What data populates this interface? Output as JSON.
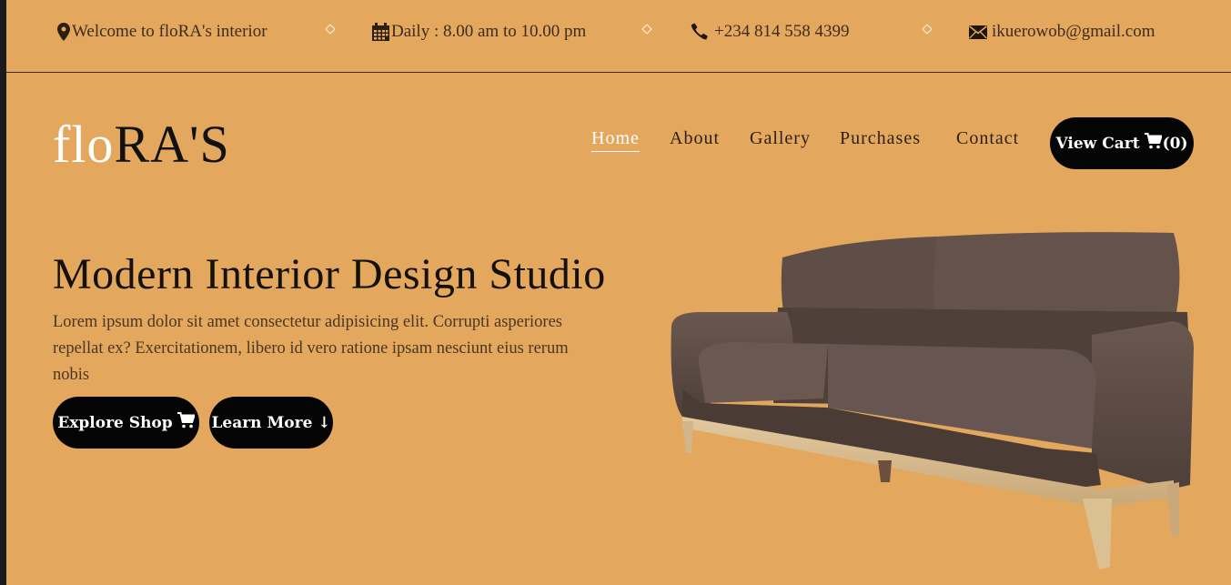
{
  "topbar": {
    "welcome": "Welcome to floRA's interior",
    "hours": "Daily : 8.00 am to 10.00 pm",
    "phone": "+234 814 558 4399",
    "email": "ikuerowob@gmail.com"
  },
  "header": {
    "logo_light": "flo",
    "logo_dark": "RA'S",
    "nav": [
      "Home",
      "About",
      "Gallery",
      "Purchases",
      "Contact"
    ],
    "active_nav": "Home",
    "cart_label": "View Cart",
    "cart_count": "(0)"
  },
  "hero": {
    "title": "Modern Interior Design Studio",
    "text": "Lorem ipsum dolor sit amet consectetur adipisicing elit. Corrupti asperiores repellat ex? Exercitationem, libero id vero ratione ipsam nesciunt eius rerum nobis",
    "explore_label": "Explore Shop",
    "learn_label": "Learn More ↓"
  },
  "colors": {
    "background": "#e3a85e",
    "button": "#050505",
    "sofa": "#5a4a43"
  },
  "icons": [
    "location-pin-icon",
    "calendar-icon",
    "phone-icon",
    "envelope-icon",
    "cart-icon"
  ]
}
